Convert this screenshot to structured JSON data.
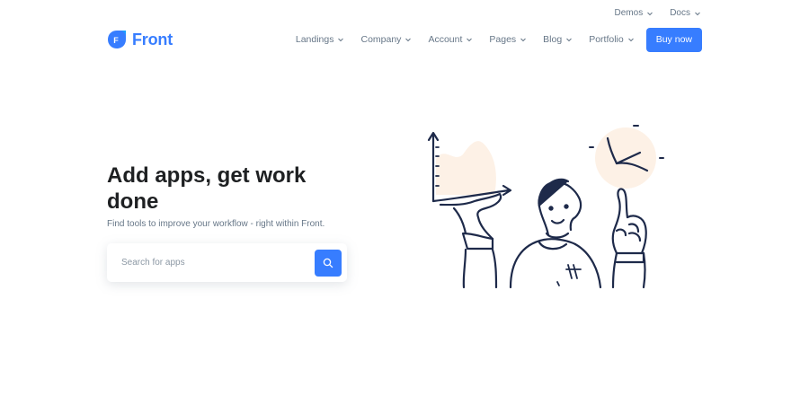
{
  "topbar": {
    "items": [
      {
        "label": "Demos",
        "icon": "chevron-down-icon"
      },
      {
        "label": "Docs",
        "icon": "chevron-down-icon"
      }
    ]
  },
  "brand": {
    "logo_letter": "F",
    "name": "Front",
    "color": "#377dff"
  },
  "nav": {
    "items": [
      {
        "label": "Landings",
        "icon": "chevron-down-icon"
      },
      {
        "label": "Company",
        "icon": "chevron-down-icon"
      },
      {
        "label": "Account",
        "icon": "chevron-down-icon"
      },
      {
        "label": "Pages",
        "icon": "chevron-down-icon"
      },
      {
        "label": "Blog",
        "icon": "chevron-down-icon"
      },
      {
        "label": "Portfolio",
        "icon": "chevron-down-icon"
      }
    ],
    "cta_label": "Buy now"
  },
  "hero": {
    "title": "Add apps, get work done",
    "subtitle": "Find tools to improve your workflow - right within Front.",
    "search": {
      "placeholder": "Search for apps",
      "value": "",
      "button_icon": "search-icon"
    },
    "illustration": "person-presenting-charts-illustration"
  },
  "colors": {
    "primary": "#377dff",
    "text_dark": "#1e2022",
    "text_muted": "#677788",
    "illustration_stroke": "#1e2a4a",
    "illustration_fill": "#fdf1e6"
  }
}
